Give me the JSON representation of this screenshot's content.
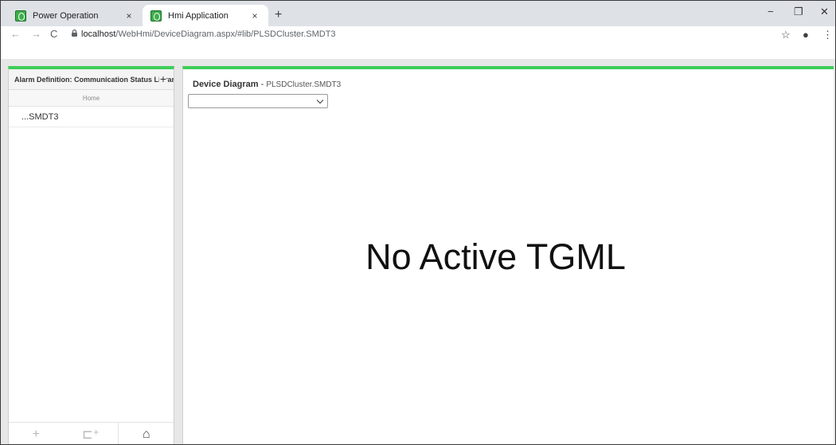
{
  "browser": {
    "tabs": [
      {
        "title": "Power Operation",
        "close": "×"
      },
      {
        "title": "Hmi Application",
        "close": "×"
      }
    ],
    "new_tab": "+",
    "window_controls": {
      "minimize": "−",
      "maximize": "❐",
      "close": "✕"
    },
    "nav": {
      "back": "←",
      "forward": "→",
      "reload": "C"
    },
    "url_host": "localhost",
    "url_path": "/WebHmi/DeviceDiagram.aspx/#lib/PLSDCluster.SMDT3",
    "toolbar_icons": {
      "star": "☆",
      "account": "●",
      "menu": "⋮"
    }
  },
  "left_panel": {
    "header": "Alarm Definition: Communication Status Library",
    "add": "+",
    "home": "Home",
    "items": [
      {
        "label": "...SMDT3"
      }
    ],
    "footer": {
      "add": "+",
      "new_folder": "⊏⁺",
      "home": "⌂"
    }
  },
  "main": {
    "title": "Device Diagram",
    "separator": " - ",
    "subtitle": "PLSDCluster.SMDT3",
    "select_value": "",
    "message": "No Active TGML"
  },
  "colors": {
    "accent": "#3dcd58"
  }
}
